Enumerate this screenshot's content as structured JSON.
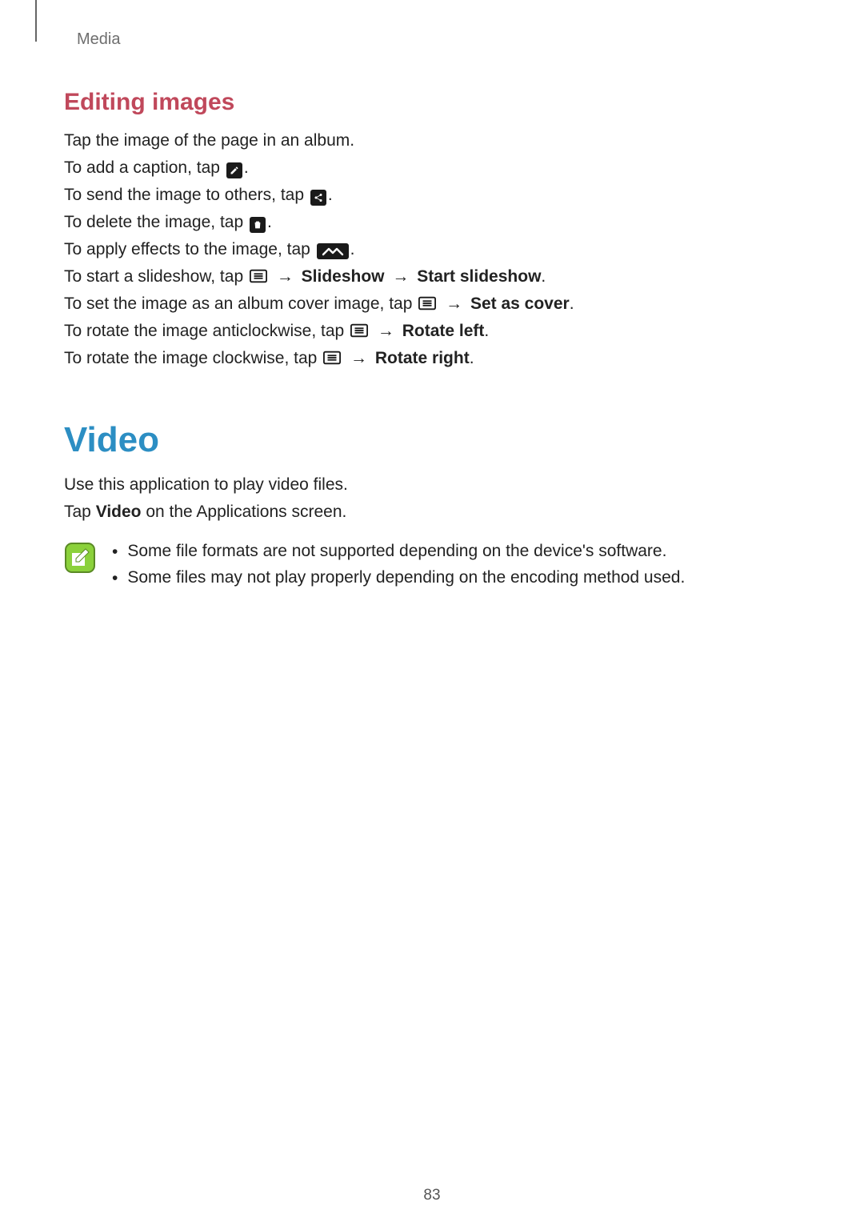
{
  "header": {
    "section": "Media"
  },
  "editing": {
    "heading": "Editing images",
    "p_intro": "Tap the image of the page in an album.",
    "p_caption_pre": "To add a caption, tap ",
    "p_caption_post": ".",
    "p_send_pre": "To send the image to others, tap ",
    "p_send_post": ".",
    "p_delete_pre": "To delete the image, tap ",
    "p_delete_post": ".",
    "p_effects_pre": "To apply effects to the image, tap ",
    "p_effects_post": ".",
    "p_slideshow_pre": "To start a slideshow, tap ",
    "arrow": "→",
    "slideshow_bold1": "Slideshow",
    "slideshow_bold2": "Start slideshow",
    "p_slideshow_post": ".",
    "p_cover_pre": "To set the image as an album cover image, tap ",
    "cover_bold": "Set as cover",
    "p_cover_post": ".",
    "p_rotleft_pre": "To rotate the image anticlockwise, tap ",
    "rotleft_bold": "Rotate left",
    "p_rotleft_post": ".",
    "p_rotright_pre": "To rotate the image clockwise, tap ",
    "rotright_bold": "Rotate right",
    "p_rotright_post": "."
  },
  "video": {
    "heading": "Video",
    "p_use": "Use this application to play video files.",
    "p_tap_pre": "Tap ",
    "p_tap_bold": "Video",
    "p_tap_post": " on the Applications screen.",
    "notes": [
      "Some file formats are not supported depending on the device's software.",
      "Some files may not play properly depending on the encoding method used."
    ],
    "bullet": "•"
  },
  "page_number": "83"
}
